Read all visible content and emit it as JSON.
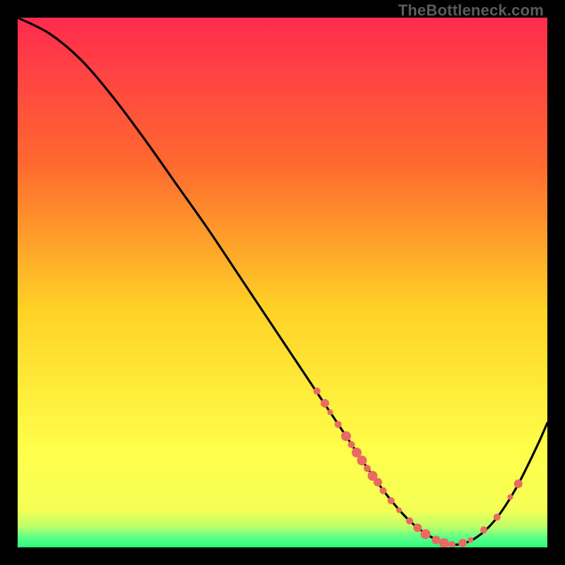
{
  "watermark": "TheBottleneck.com",
  "colors": {
    "gradient_top": "#ff2b4e",
    "gradient_mid1": "#ff8a2a",
    "gradient_mid2": "#ffe22a",
    "gradient_bottom_yellow": "#ffff55",
    "gradient_green": "#2bff7a",
    "curve": "#000000",
    "marker": "#e86a62",
    "background": "#000000"
  },
  "chart_data": {
    "type": "line",
    "title": "",
    "xlabel": "",
    "ylabel": "",
    "xlim": [
      0,
      100
    ],
    "ylim": [
      0,
      100
    ],
    "curve": {
      "x": [
        0,
        6,
        12,
        18,
        24,
        30,
        36,
        42,
        48,
        54,
        58,
        62,
        66,
        70,
        74,
        78,
        82,
        86,
        90,
        94,
        98,
        100
      ],
      "y": [
        100,
        97,
        92,
        85,
        77,
        68.5,
        60,
        51,
        42,
        33,
        27,
        21,
        15,
        9.5,
        5,
        2,
        0.5,
        1.5,
        5,
        11,
        19,
        23.5
      ]
    },
    "markers": [
      {
        "x": 56.5,
        "y": 29.5,
        "r": 5
      },
      {
        "x": 58.0,
        "y": 27.2,
        "r": 6
      },
      {
        "x": 59.0,
        "y": 25.5,
        "r": 4
      },
      {
        "x": 60.5,
        "y": 23.2,
        "r": 5
      },
      {
        "x": 62.0,
        "y": 21.0,
        "r": 7
      },
      {
        "x": 63.0,
        "y": 19.4,
        "r": 5
      },
      {
        "x": 64.0,
        "y": 17.9,
        "r": 7
      },
      {
        "x": 65.0,
        "y": 16.4,
        "r": 7
      },
      {
        "x": 66.0,
        "y": 14.9,
        "r": 5
      },
      {
        "x": 67.0,
        "y": 13.5,
        "r": 7
      },
      {
        "x": 68.0,
        "y": 12.3,
        "r": 6
      },
      {
        "x": 69.0,
        "y": 10.7,
        "r": 5
      },
      {
        "x": 70.5,
        "y": 8.8,
        "r": 5
      },
      {
        "x": 72.0,
        "y": 7.0,
        "r": 4
      },
      {
        "x": 74.0,
        "y": 5.0,
        "r": 5
      },
      {
        "x": 75.5,
        "y": 3.7,
        "r": 6
      },
      {
        "x": 77.0,
        "y": 2.5,
        "r": 7
      },
      {
        "x": 79.0,
        "y": 1.4,
        "r": 6
      },
      {
        "x": 80.5,
        "y": 0.8,
        "r": 7
      },
      {
        "x": 82.0,
        "y": 0.5,
        "r": 5
      },
      {
        "x": 84.0,
        "y": 0.8,
        "r": 6
      },
      {
        "x": 85.5,
        "y": 1.4,
        "r": 4
      },
      {
        "x": 88.0,
        "y": 3.3,
        "r": 5
      },
      {
        "x": 90.5,
        "y": 5.7,
        "r": 5
      },
      {
        "x": 93.0,
        "y": 9.5,
        "r": 4
      },
      {
        "x": 94.5,
        "y": 12.0,
        "r": 6
      }
    ],
    "green_band": {
      "y_start": 0,
      "y_end": 4.5
    }
  }
}
